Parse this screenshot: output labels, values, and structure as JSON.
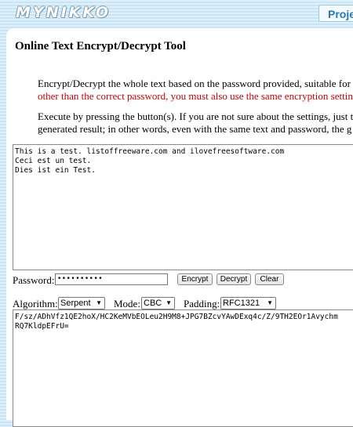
{
  "header": {
    "logo_text": "MYNIKKO",
    "nav_tab": "Proje"
  },
  "page": {
    "title": "Online Text Encrypt/Decrypt Tool",
    "para1_line1": "Encrypt/Decrypt the whole text based on the password provided, suitable for",
    "para1_line2": "other than the correct password, you must also use the same encryption settin",
    "para2_line1": "Execute by pressing the button(s). If you are not sure about the settings, just t",
    "para2_line2": "generated result; in other words, even with the same text and password, the g"
  },
  "input": {
    "text": "This is a test. listoffreeware.com and ilovefreesoftware.com\nCeci est un test.\nDies ist ein Test."
  },
  "password": {
    "label": "Password:",
    "value": "••••••••••"
  },
  "buttons": {
    "encrypt": "Encrypt",
    "decrypt": "Decrypt",
    "clear": "Clear"
  },
  "options": {
    "algorithm_label": "Algorithm:",
    "algorithm_value": "Serpent",
    "mode_label": "Mode:",
    "mode_value": "CBC",
    "padding_label": "Padding:",
    "padding_value": "RFC1321"
  },
  "output": {
    "text": "F/sz/ADhVfz1QE2hoX/HC2KeMVbEOLeu2H9M8+JPG7BZcvYAwDExq4c/Z/9TH2EOr1Avychm\nRQ7KldpEFrU="
  }
}
